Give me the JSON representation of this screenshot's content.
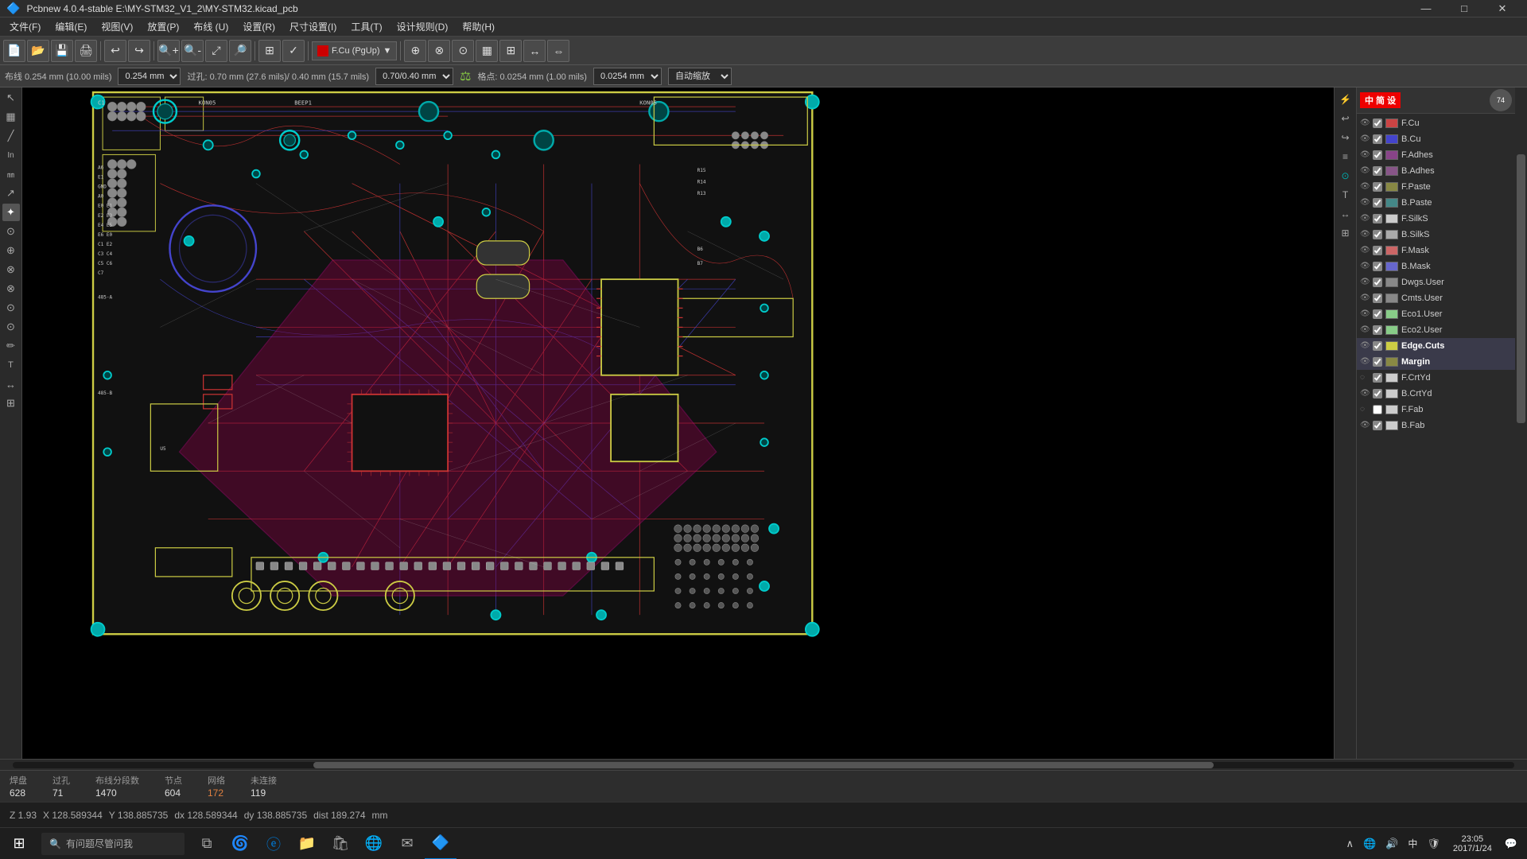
{
  "titlebar": {
    "title": "Pcbnew 4.0.4-stable E:\\MY-STM32_V1_2\\MY-STM32.kicad_pcb",
    "controls": [
      "—",
      "□",
      "✕"
    ]
  },
  "menubar": {
    "items": [
      "文件(F)",
      "编辑(E)",
      "视图(V)",
      "放置(P)",
      "布线 (U)",
      "设置(R)",
      "尺寸设置(I)",
      "工具(T)",
      "设计规则(D)",
      "帮助(H)"
    ]
  },
  "toolbar": {
    "layer_selector": "F.Cu (PgUp)",
    "layer_color": "#cc0000"
  },
  "toolbar2": {
    "trace_width_label": "布线 0.254 mm (10.00 mils)",
    "via_size_label": "过孔: 0.70 mm (27.6 mils)/ 0.40 mm (15.7 mils)",
    "grid_label": "格点: 0.0254 mm (1.00 mils)",
    "zoom_label": "自动缩放",
    "track_star": "*",
    "via_star": "*"
  },
  "statusbar": {
    "items": [
      {
        "label": "焊盘",
        "value": "628"
      },
      {
        "label": "过孔",
        "value": "71"
      },
      {
        "label": "布线分段数",
        "value": "1470"
      },
      {
        "label": "节点",
        "value": "604"
      },
      {
        "label": "网络",
        "value": "172",
        "highlight": true
      },
      {
        "label": "未连接",
        "value": "119"
      }
    ]
  },
  "coordbar": {
    "z": "Z 1.93",
    "x": "X 128.589344",
    "y": "Y 138.885735",
    "dx": "dx 128.589344",
    "dy": "dy 138.885735",
    "dist": "dist 189.274",
    "unit": "mm"
  },
  "layers": [
    {
      "name": "F.Cu",
      "color": "#cc4444",
      "checked": true,
      "visible": true
    },
    {
      "name": "B.Cu",
      "color": "#4444cc",
      "checked": true,
      "visible": true
    },
    {
      "name": "F.Adhes",
      "color": "#884488",
      "checked": true,
      "visible": true
    },
    {
      "name": "B.Adhes",
      "color": "#885588",
      "checked": true,
      "visible": true
    },
    {
      "name": "F.Paste",
      "color": "#888844",
      "checked": true,
      "visible": true
    },
    {
      "name": "B.Paste",
      "color": "#448888",
      "checked": true,
      "visible": true
    },
    {
      "name": "F.SilkS",
      "color": "#cccccc",
      "checked": true,
      "visible": true
    },
    {
      "name": "B.SilkS",
      "color": "#aaaaaa",
      "checked": true,
      "visible": true
    },
    {
      "name": "F.Mask",
      "color": "#cc6666",
      "checked": true,
      "visible": true
    },
    {
      "name": "B.Mask",
      "color": "#6666cc",
      "checked": true,
      "visible": true
    },
    {
      "name": "Dwgs.User",
      "color": "#888888",
      "checked": true,
      "visible": true
    },
    {
      "name": "Cmts.User",
      "color": "#888888",
      "checked": true,
      "visible": true
    },
    {
      "name": "Eco1.User",
      "color": "#88cc88",
      "checked": true,
      "visible": true
    },
    {
      "name": "Eco2.User",
      "color": "#88cc88",
      "checked": true,
      "visible": true
    },
    {
      "name": "Edge.Cuts",
      "color": "#cccc44",
      "checked": true,
      "visible": true
    },
    {
      "name": "Margin",
      "color": "#888844",
      "checked": true,
      "visible": true
    },
    {
      "name": "F.CrtYd",
      "color": "#cccccc",
      "checked": true,
      "visible": false
    },
    {
      "name": "B.CrtYd",
      "color": "#cccccc",
      "checked": true,
      "visible": true
    },
    {
      "name": "F.Fab",
      "color": "#cccccc",
      "checked": false,
      "visible": false
    },
    {
      "name": "B.Fab",
      "color": "#cccccc",
      "checked": true,
      "visible": true
    }
  ],
  "lang_badge": "中 简 设",
  "taskbar": {
    "search_placeholder": "有问题尽管问我",
    "time": "23:05",
    "date": "2017/1/24",
    "lang": "中"
  },
  "right_panel_icons": [
    "⚡",
    "⟲",
    "⟳",
    "≡",
    "⊞",
    "⊕"
  ],
  "left_toolbar_icons": [
    "⊕",
    "▦",
    "╱",
    "In",
    "㎜",
    "↖",
    "✦",
    "⊙",
    "⊗",
    "⊗",
    "⊗",
    "⊙",
    "⊙",
    "⊙",
    "⊙",
    "⊕",
    "⊗"
  ],
  "network_count": "172"
}
